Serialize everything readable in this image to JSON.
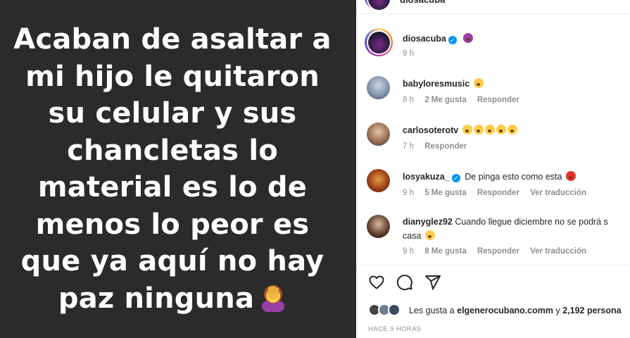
{
  "story": {
    "lines": [
      "Acaban de asaltar a",
      "mi hijo le quitaron",
      "su celular y sus",
      "chancletas lo",
      "material es lo de",
      "menos lo peor es",
      "que ya aquí no hay",
      "paz ninguna"
    ]
  },
  "header": {
    "username": "diosacuba"
  },
  "caption": {
    "username": "diosacuba",
    "time": "9 h"
  },
  "comments": [
    {
      "username": "babyloresmusic",
      "text": "",
      "time": "8 h",
      "likes": "2 Me gusta",
      "reply": "Responder",
      "translate": ""
    },
    {
      "username": "carlosoterotv",
      "text": "",
      "time": "7 h",
      "likes": "",
      "reply": "Responder",
      "translate": ""
    },
    {
      "username": "losyakuza_",
      "text": "De pinga esto como esta",
      "time": "9 h",
      "likes": "5 Me gusta",
      "reply": "Responder",
      "translate": "Ver traducción"
    },
    {
      "username": "dianyglez92",
      "text": "Cuando llegue diciembre no se podrá s",
      "text2": "casa",
      "time": "9 h",
      "likes": "8 Me gusta",
      "reply": "Responder",
      "translate": "Ver traducción"
    }
  ],
  "likes": {
    "prefix": "Les gusta a",
    "user": "elgenerocubano.comm",
    "joiner": "y",
    "count": "2,192 persona"
  },
  "time_ago": "HACE 9 HORAS",
  "colors": {
    "story_bg": "#2b2b2b",
    "verified": "#0095f6",
    "meta": "#8e8e8e"
  }
}
